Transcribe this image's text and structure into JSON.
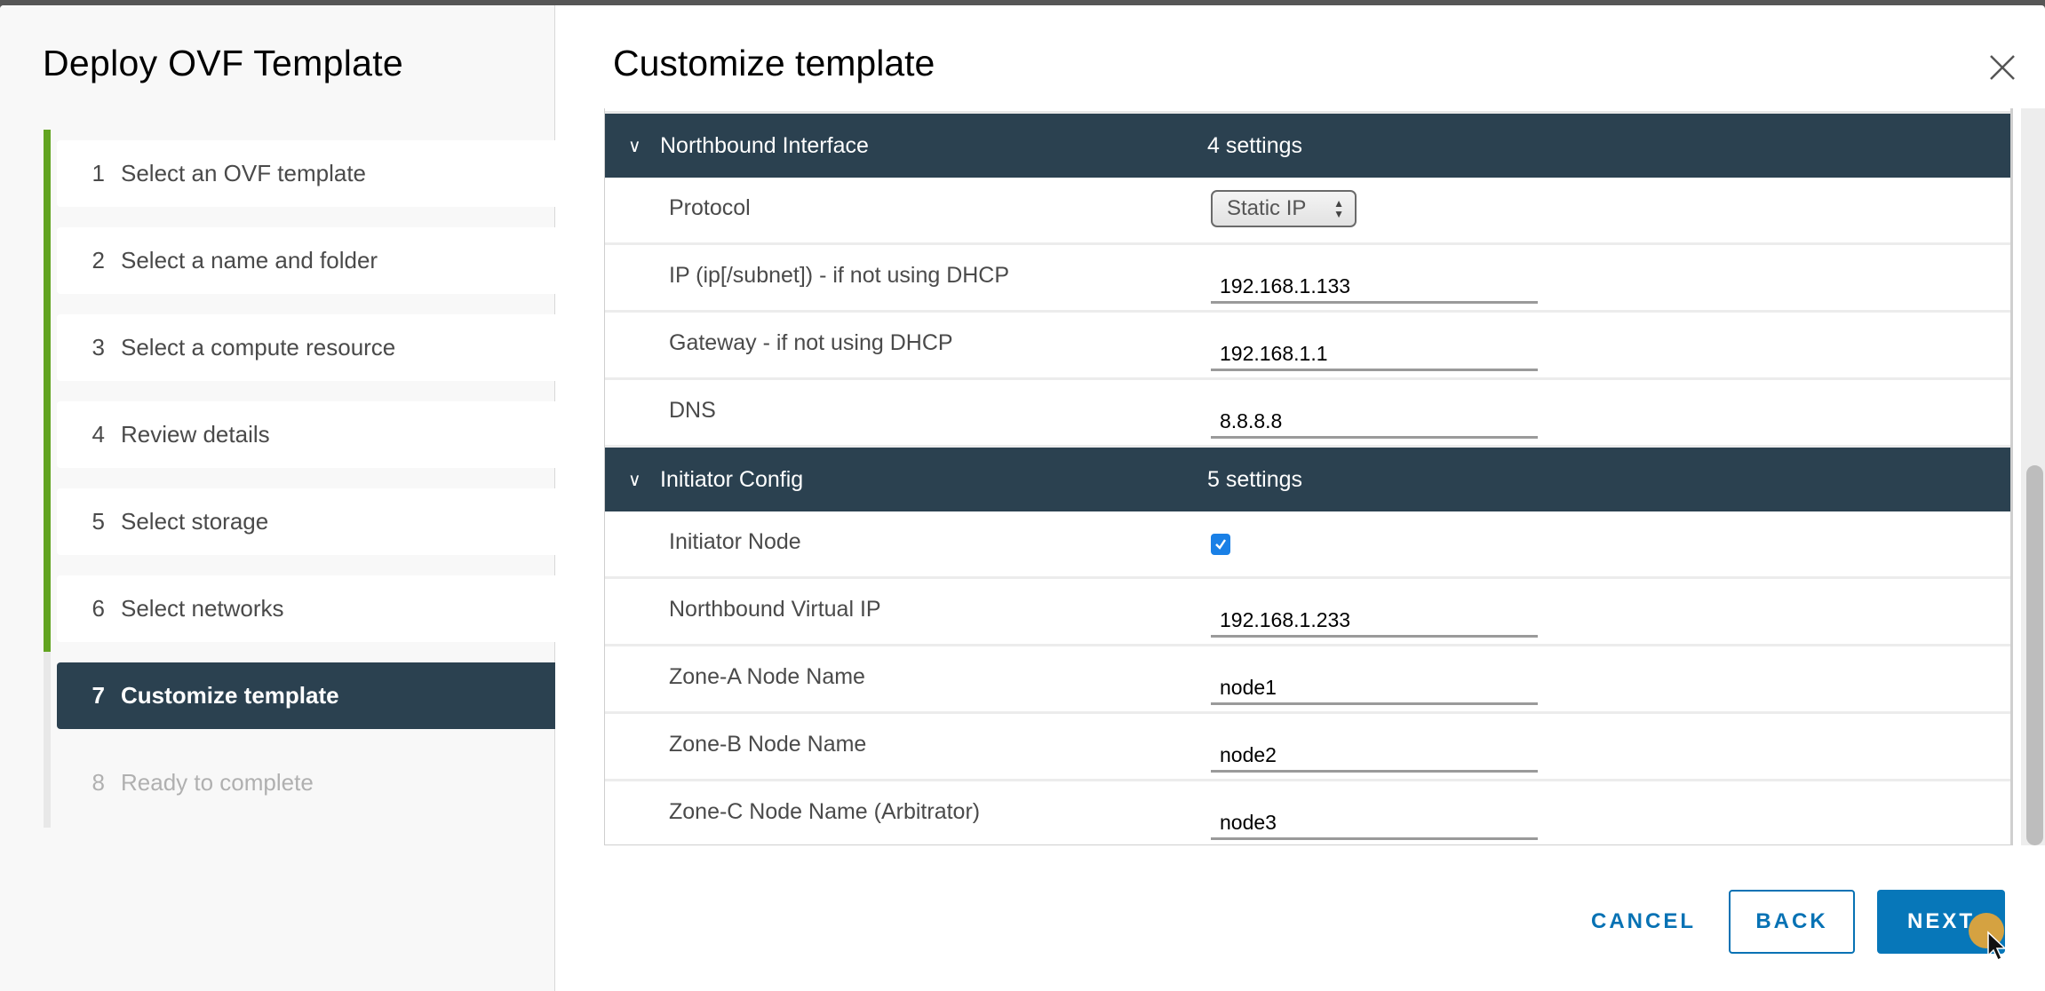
{
  "wizard": {
    "title": "Deploy OVF Template",
    "steps": [
      {
        "num": "1",
        "label": "Select an OVF template",
        "state": "completed"
      },
      {
        "num": "2",
        "label": "Select a name and folder",
        "state": "completed"
      },
      {
        "num": "3",
        "label": "Select a compute resource",
        "state": "completed"
      },
      {
        "num": "4",
        "label": "Review details",
        "state": "completed"
      },
      {
        "num": "5",
        "label": "Select storage",
        "state": "completed"
      },
      {
        "num": "6",
        "label": "Select networks",
        "state": "completed"
      },
      {
        "num": "7",
        "label": "Customize template",
        "state": "active"
      },
      {
        "num": "8",
        "label": "Ready to complete",
        "state": "disabled"
      }
    ]
  },
  "content": {
    "title": "Customize template",
    "close_icon": "close-icon",
    "groups": [
      {
        "name": "Northbound Interface",
        "count": "4 settings",
        "expanded": true,
        "settings": [
          {
            "label": "Protocol",
            "type": "select",
            "value": "Static IP"
          },
          {
            "label": "IP (ip[/subnet]) - if not using DHCP",
            "type": "text",
            "value": "192.168.1.133"
          },
          {
            "label": "Gateway - if not using DHCP",
            "type": "text",
            "value": "192.168.1.1"
          },
          {
            "label": "DNS",
            "type": "text",
            "value": "8.8.8.8"
          }
        ]
      },
      {
        "name": "Initiator Config",
        "count": "5 settings",
        "expanded": true,
        "settings": [
          {
            "label": "Initiator Node",
            "type": "checkbox",
            "checked": true
          },
          {
            "label": "Northbound Virtual IP",
            "type": "text",
            "value": "192.168.1.233"
          },
          {
            "label": "Zone-A Node Name",
            "type": "text",
            "value": "node1"
          },
          {
            "label": "Zone-B Node Name",
            "type": "text",
            "value": "node2"
          },
          {
            "label": "Zone-C Node Name (Arbitrator)",
            "type": "text",
            "value": "node3"
          }
        ]
      }
    ]
  },
  "footer": {
    "cancel_label": "CANCEL",
    "back_label": "BACK",
    "next_label": "NEXT"
  },
  "colors": {
    "accent": "#0777b9",
    "progress": "#62a420",
    "active_step": "#2b4150",
    "group_header": "#2b4150",
    "checkbox": "#1a80e6"
  }
}
